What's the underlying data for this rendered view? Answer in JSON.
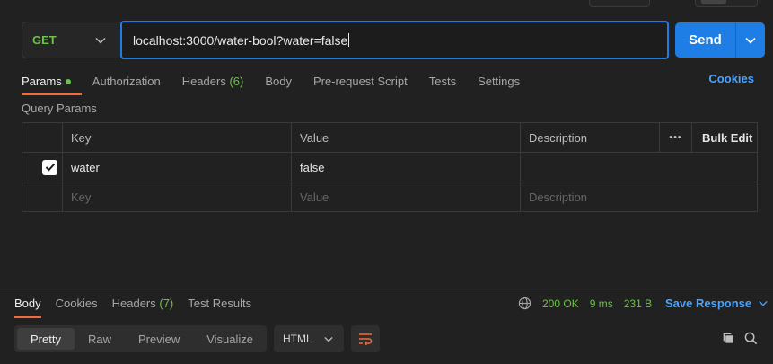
{
  "request": {
    "method": "GET",
    "url": "localhost:3000/water-bool?water=false",
    "send_label": "Send"
  },
  "tabs": [
    {
      "label": "Params",
      "active": true
    },
    {
      "label": "Authorization"
    },
    {
      "label": "Headers",
      "count": "(6)"
    },
    {
      "label": "Body"
    },
    {
      "label": "Pre-request Script"
    },
    {
      "label": "Tests"
    },
    {
      "label": "Settings"
    }
  ],
  "cookies_label": "Cookies",
  "query_params_label": "Query Params",
  "params_table": {
    "headers": {
      "key": "Key",
      "value": "Value",
      "description": "Description",
      "bulk_edit": "Bulk Edit",
      "more": "•••"
    },
    "rows": [
      {
        "checked": true,
        "key": "water",
        "value": "false",
        "description": ""
      }
    ],
    "placeholders": {
      "key": "Key",
      "value": "Value",
      "description": "Description"
    }
  },
  "response": {
    "tabs": [
      {
        "label": "Body",
        "active": true
      },
      {
        "label": "Cookies"
      },
      {
        "label": "Headers",
        "count": "(7)"
      },
      {
        "label": "Test Results"
      }
    ],
    "status": "200 OK",
    "time": "9 ms",
    "size": "231 B",
    "save_label": "Save Response",
    "view_modes": [
      "Pretty",
      "Raw",
      "Preview",
      "Visualize"
    ],
    "format": "HTML"
  },
  "colors": {
    "accent_blue": "#1f7de6",
    "link_blue": "#4aa3ff",
    "success_green": "#6cc24a",
    "active_tab_orange": "#f26b3a"
  }
}
